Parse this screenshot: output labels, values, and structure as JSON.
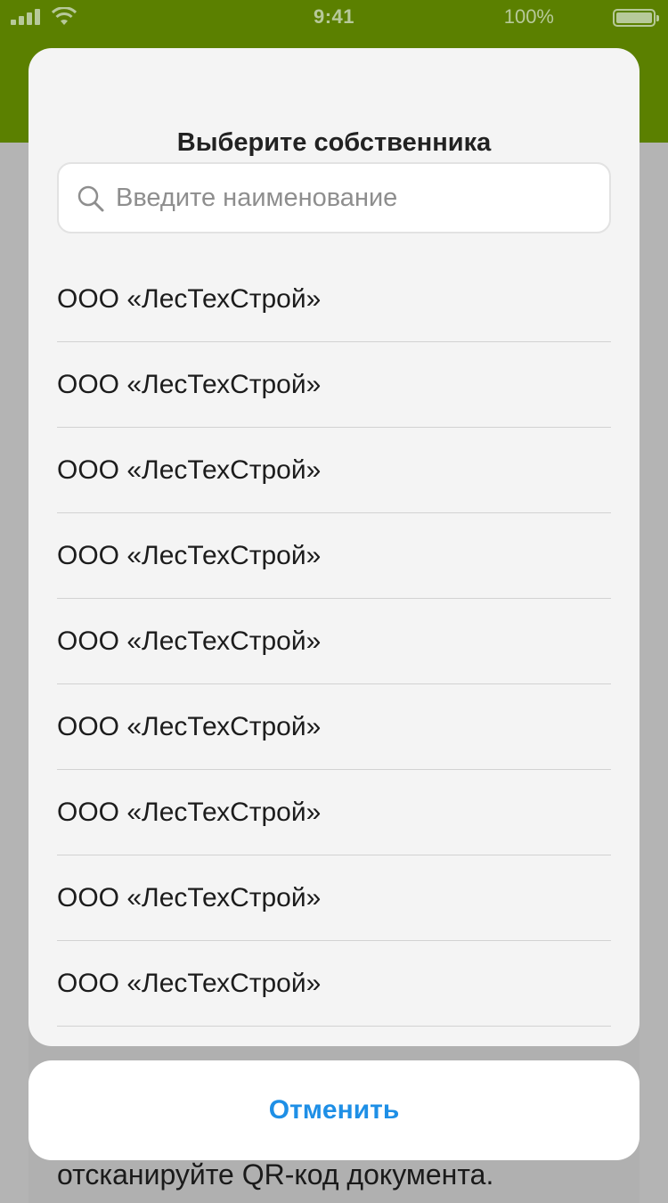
{
  "status_bar": {
    "time": "9:41",
    "battery": "100%"
  },
  "background": {
    "hint_text": "отсканируйте QR-код документа."
  },
  "picker": {
    "title": "Выберите собственника",
    "search": {
      "placeholder": "Введите наименование",
      "value": ""
    },
    "items": [
      {
        "label": "ООО «ЛесТехСтрой»"
      },
      {
        "label": "ООО «ЛесТехСтрой»"
      },
      {
        "label": "ООО «ЛесТехСтрой»"
      },
      {
        "label": "ООО «ЛесТехСтрой»"
      },
      {
        "label": "ООО «ЛесТехСтрой»"
      },
      {
        "label": "ООО «ЛесТехСтрой»"
      },
      {
        "label": "ООО «ЛесТехСтрой»"
      },
      {
        "label": "ООО «ЛесТехСтрой»"
      },
      {
        "label": "ООО «ЛесТехСтрой»"
      }
    ],
    "cancel_label": "Отменить"
  },
  "colors": {
    "header": "#5b8000",
    "accent": "#1e8fe6",
    "sheet": "#f4f4f4",
    "overlay": "#b4b4b4"
  }
}
